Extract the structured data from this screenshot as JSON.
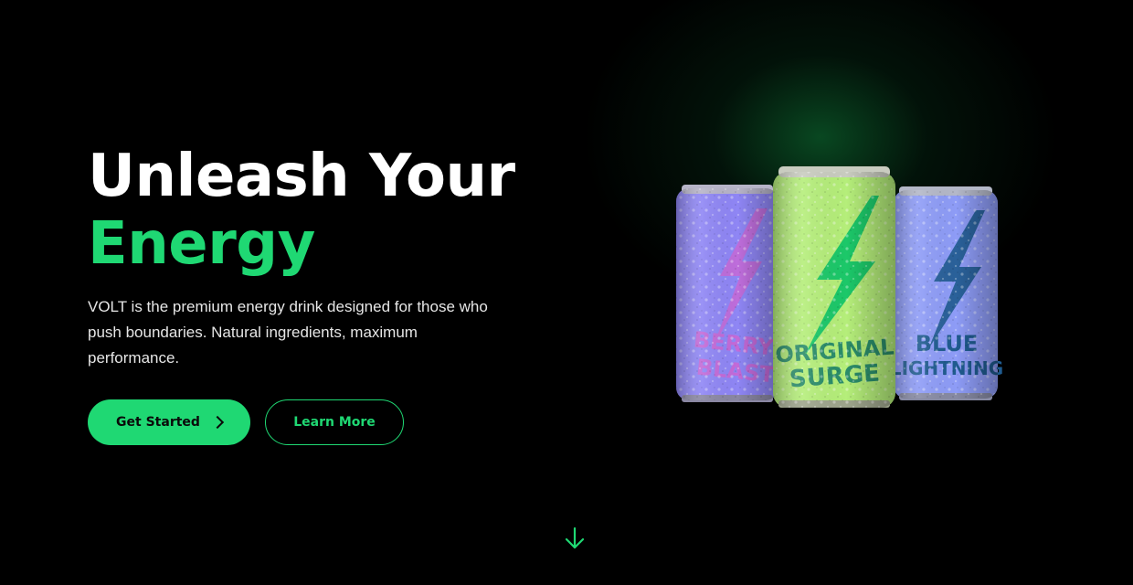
{
  "hero": {
    "headline_line1": "Unleash Your",
    "headline_line2": "Energy",
    "description": "VOLT is the premium energy drink designed for those who push boundaries. Natural ingredients, maximum performance.",
    "primary_button": "Get Started",
    "secondary_button": "Learn More"
  },
  "products": [
    {
      "line1": "BERRY",
      "line2": "BLAST",
      "can_color": "#8f86f5",
      "accent_color": "#c36ad8"
    },
    {
      "line1": "ORIGINAL",
      "line2": "SURGE",
      "can_color": "#b5ee7a",
      "accent_color": "#1cc869"
    },
    {
      "line1": "BLUE",
      "line2": "LIGHTNING",
      "can_color": "#8e9cf7",
      "accent_color": "#1f5b8f"
    }
  ],
  "icons": {
    "button_arrow": "chevron-right-icon",
    "scroll": "arrow-down-icon"
  },
  "colors": {
    "accent": "#1fd873",
    "background": "#000000"
  }
}
